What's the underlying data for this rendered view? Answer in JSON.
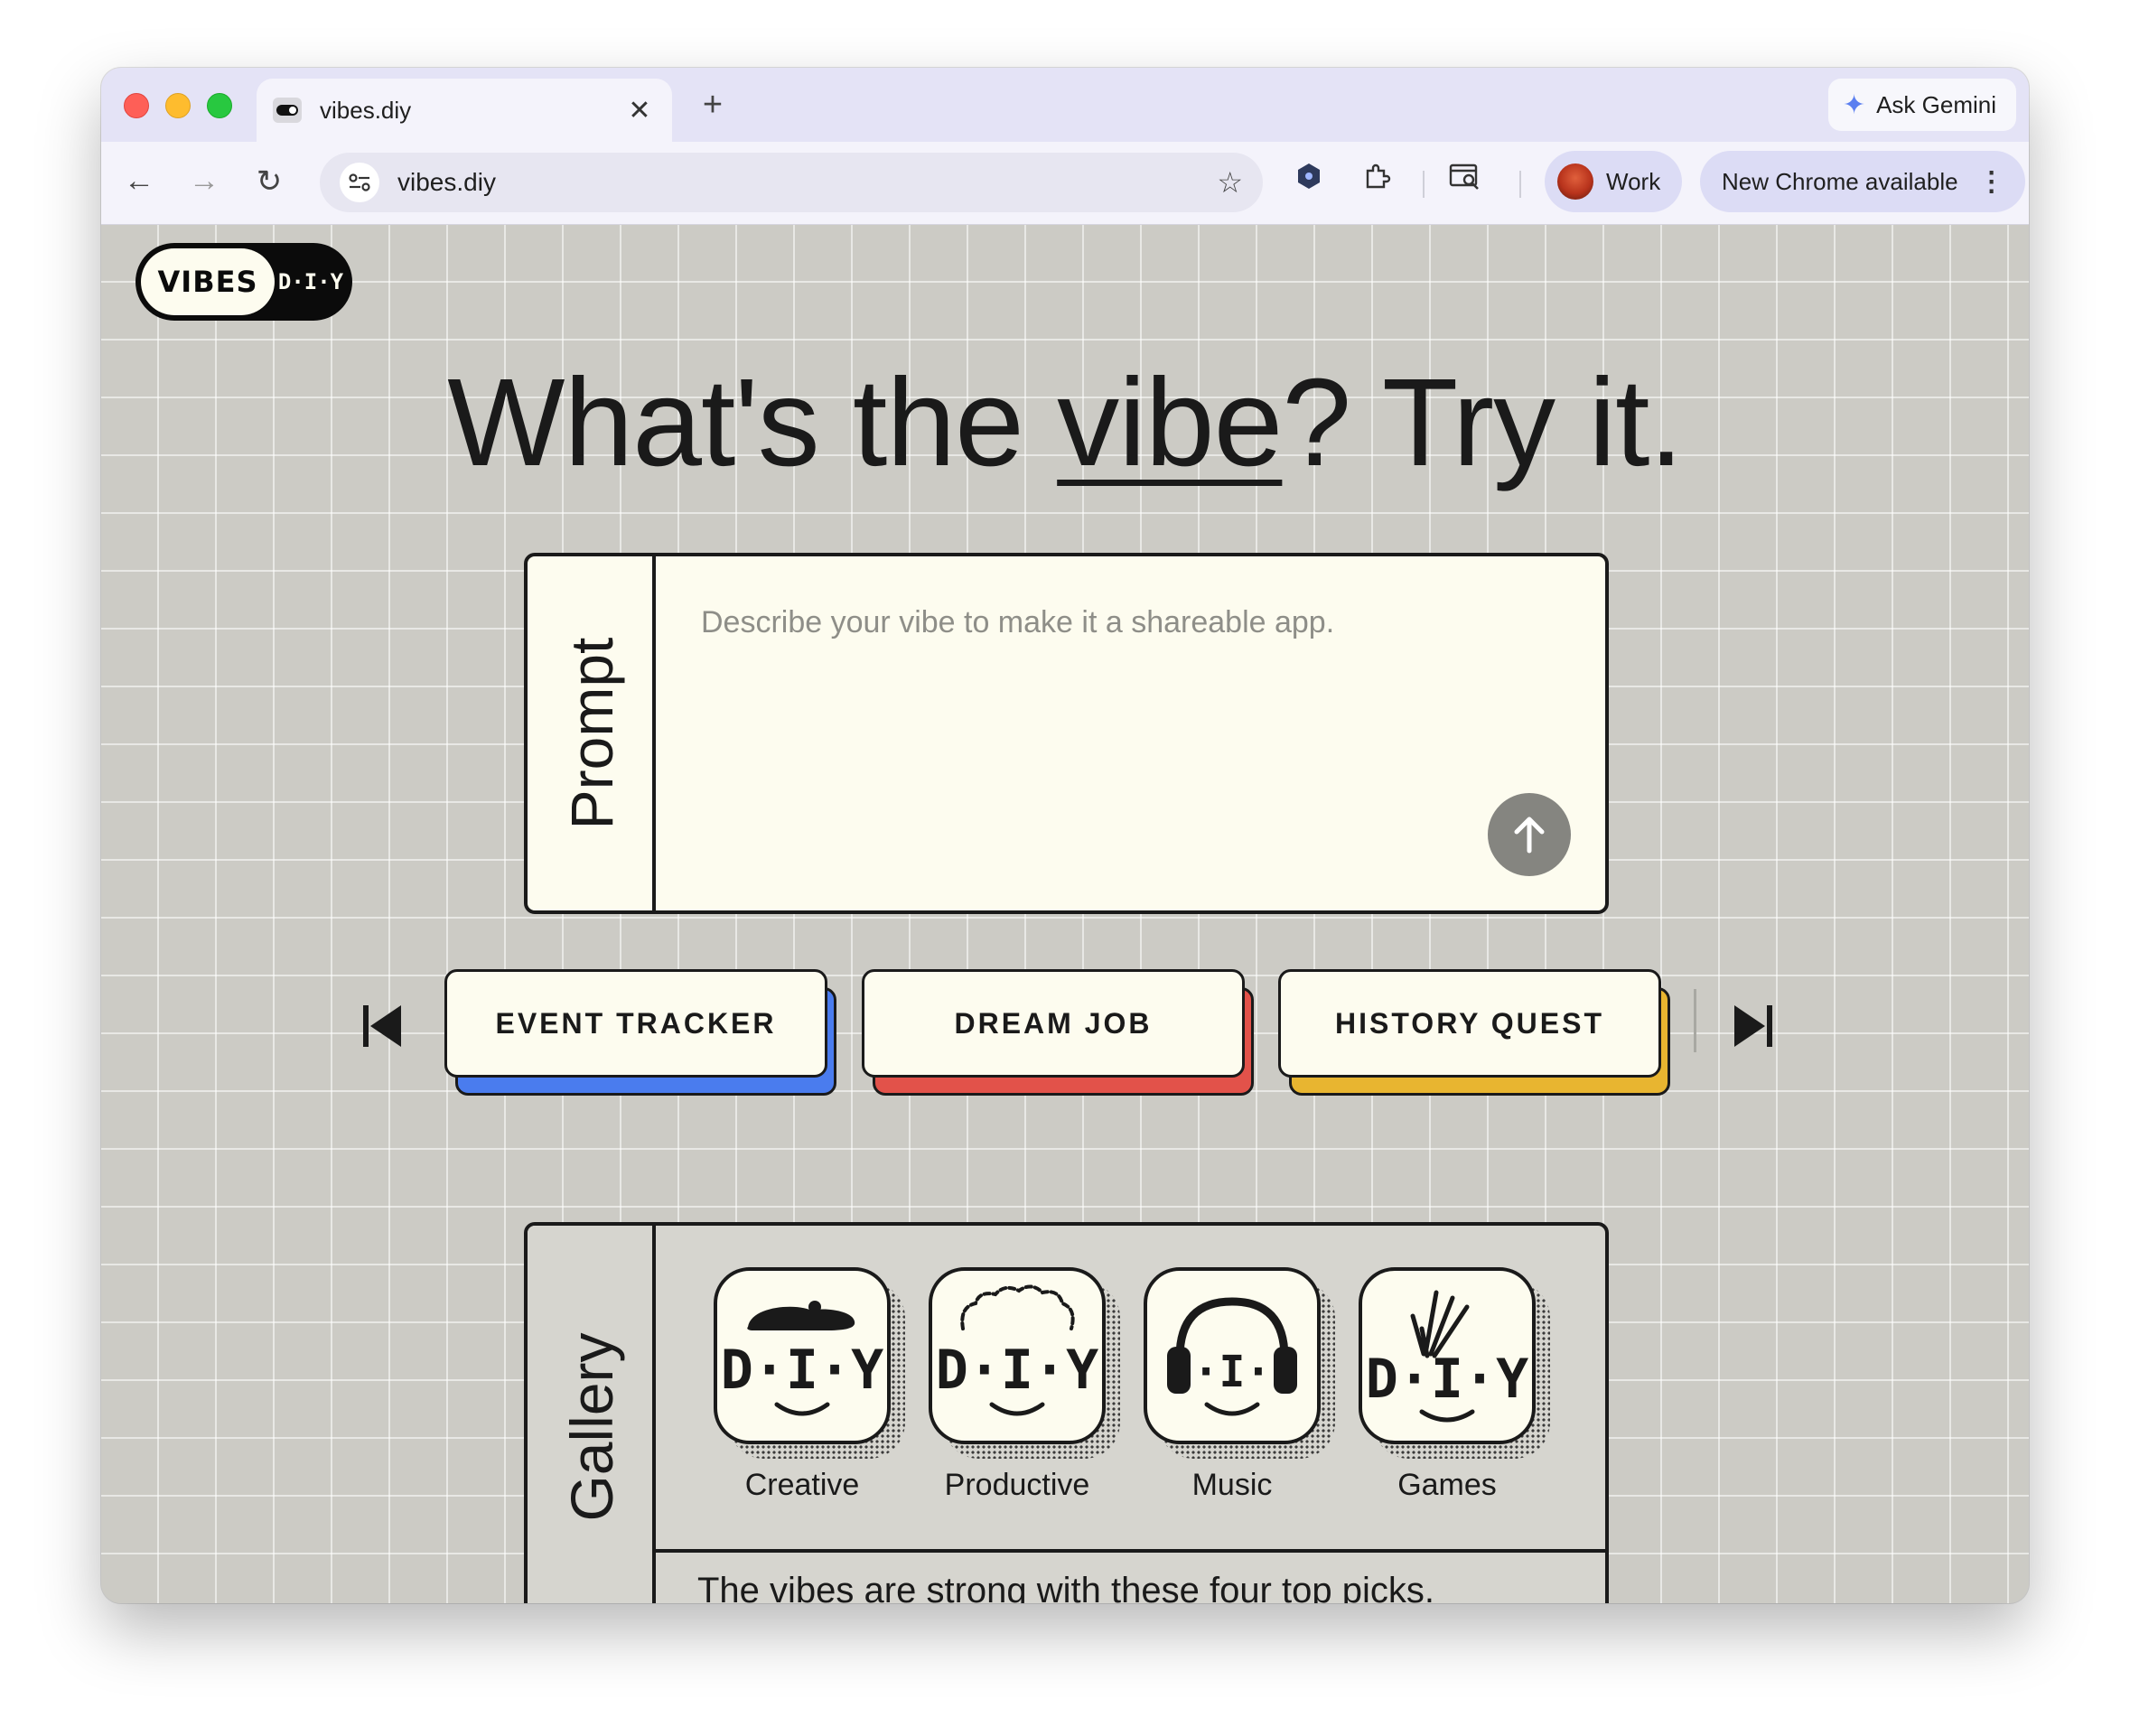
{
  "browser": {
    "tab_title": "vibes.diy",
    "tab_close": "✕",
    "new_tab": "+",
    "gemini_label": "Ask Gemini",
    "url": "vibes.diy",
    "profile_label": "Work",
    "update_label": "New Chrome available",
    "nav_back": "←",
    "nav_forward": "→",
    "nav_reload": "↻",
    "bookmark_star": "☆",
    "kebab": "⋮"
  },
  "logo": {
    "left": "VIBES",
    "right": "D·I·Y"
  },
  "headline": {
    "before": "What's the ",
    "emphasis": "vibe",
    "after": "? Try it."
  },
  "prompt": {
    "side_label": "Prompt",
    "placeholder": "Describe your vibe to make it a shareable app."
  },
  "chips": [
    {
      "label": "EVENT TRACKER",
      "color": "#4a7cee"
    },
    {
      "label": "DREAM JOB",
      "color": "#e2524a"
    },
    {
      "label": "HISTORY QUEST",
      "color": "#e8b530"
    }
  ],
  "gallery": {
    "side_label": "Gallery",
    "items": [
      {
        "label": "Creative",
        "icon": "beret-face-icon"
      },
      {
        "label": "Productive",
        "icon": "curly-hair-face-icon"
      },
      {
        "label": "Music",
        "icon": "headphones-face-icon"
      },
      {
        "label": "Games",
        "icon": "wild-hair-face-icon"
      }
    ],
    "caption": "The vibes are strong with these four top picks."
  },
  "colors": {
    "page_bg": "#cccbc5",
    "card_bg": "#fdfcef",
    "ink": "#1a1a1a",
    "send_button": "#858580"
  }
}
